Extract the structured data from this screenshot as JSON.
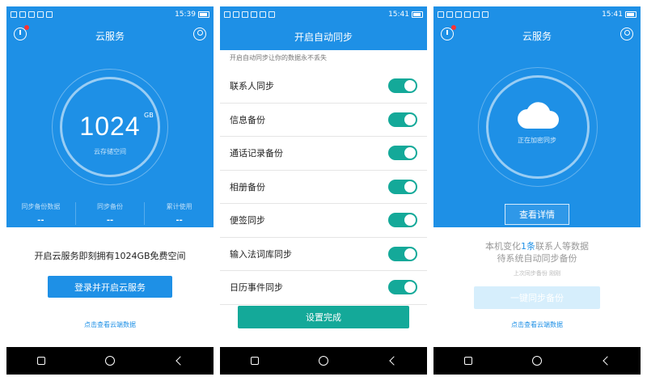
{
  "status": {
    "time1": "15:39",
    "time2": "15:41",
    "time3": "15:41"
  },
  "screen1": {
    "title": "云服务",
    "storage_value": "1024",
    "storage_unit": "GB",
    "storage_label": "云存储空间",
    "stats": [
      {
        "label": "同步备份数据",
        "value": "--"
      },
      {
        "label": "同步备份",
        "value": "--"
      },
      {
        "label": "累计使用",
        "value": "--"
      }
    ],
    "promo": "开启云服务即刻拥有1024GB免费空间",
    "login_button": "登录并开启云服务",
    "view_link": "点击查看云端数据"
  },
  "screen2": {
    "title": "开启自动同步",
    "subtitle": "开启自动同步让你的数据永不丢失",
    "items": [
      {
        "label": "联系人同步",
        "on": true
      },
      {
        "label": "信息备份",
        "on": true
      },
      {
        "label": "通话记录备份",
        "on": true
      },
      {
        "label": "相册备份",
        "on": true
      },
      {
        "label": "便签同步",
        "on": true
      },
      {
        "label": "输入法词库同步",
        "on": true
      },
      {
        "label": "日历事件同步",
        "on": true
      }
    ],
    "done_button": "设置完成"
  },
  "screen3": {
    "title": "云服务",
    "cloud_label": "正在加密同步",
    "detail_button": "查看详情",
    "msg_prefix": "本机变化",
    "msg_highlight": "1条",
    "msg_suffix": "联系人等数据",
    "msg_line2": "待系统自动同步备份",
    "last_sync": "上次同步备份 刚刚",
    "sync_button": "一键同步备份",
    "view_link": "点击查看云端数据"
  },
  "colors": {
    "primary": "#1e90e6",
    "teal": "#14a999",
    "navbar": "#000000"
  }
}
